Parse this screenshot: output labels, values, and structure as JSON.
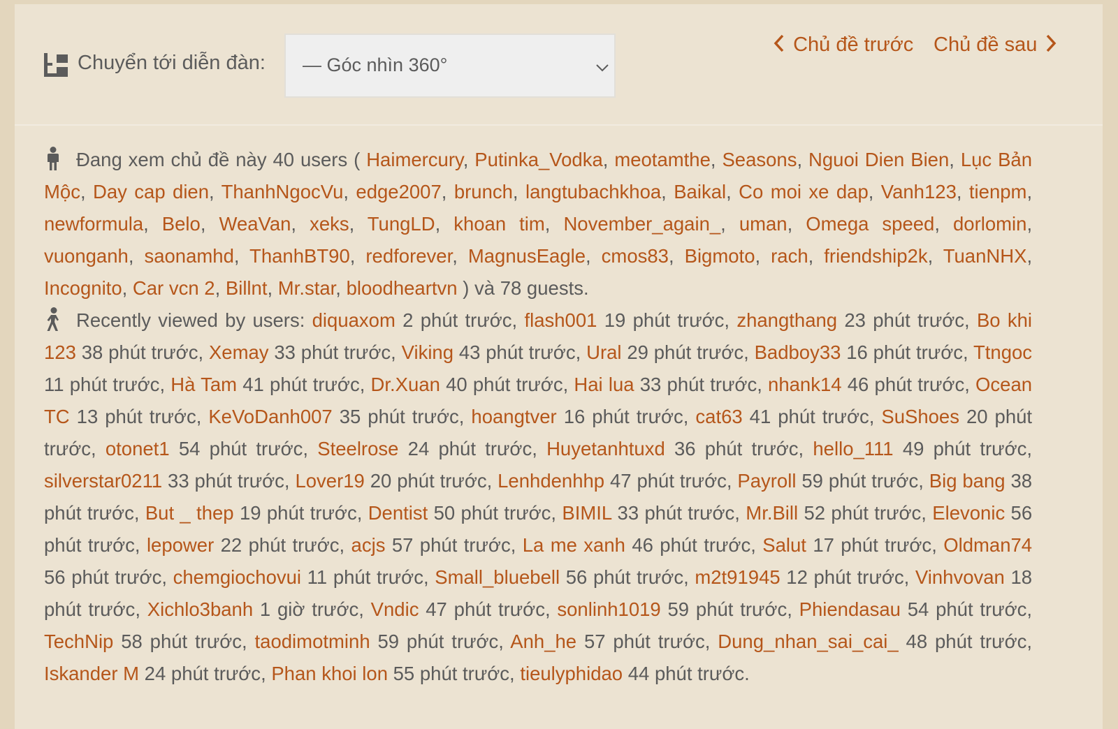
{
  "jump": {
    "label": "Chuyển tới diễn đàn:",
    "selected_forum": "— Góc nhìn 360°"
  },
  "topic_nav": {
    "prev_label": "Chủ đề trước",
    "next_label": "Chủ đề sau"
  },
  "viewing": {
    "prefix": "Đang xem chủ đề này 40 users (",
    "users": [
      "Haimercury",
      "Putinka_Vodka",
      "meotamthe",
      "Seasons",
      "Nguoi Dien Bien",
      "Lục Bản Mộc",
      "Day cap dien",
      "ThanhNgocVu",
      "edge2007",
      "brunch",
      "langtubachkhoa",
      "Baikal",
      "Co moi xe dap",
      "Vanh123",
      "tienpm",
      "newformula",
      "Belo",
      "WeaVan",
      "xeks",
      "TungLD",
      "khoan tim",
      "November_again_",
      "uman",
      "Omega speed",
      "dorlomin",
      "vuonganh",
      "saonamhd",
      "ThanhBT90",
      "redforever",
      "MagnusEagle",
      "cmos83",
      "Bigmoto",
      "rach",
      "friendship2k",
      "TuanNHX",
      "Incognito",
      "Car vcn 2",
      "Billnt",
      "Mr.star",
      "bloodheartvn"
    ],
    "suffix": ") và 78 guests."
  },
  "recent": {
    "prefix": "Recently viewed by users:",
    "entries": [
      {
        "user": "diquaxom",
        "time": "2 phút trước"
      },
      {
        "user": "flash001",
        "time": "19 phút trước"
      },
      {
        "user": "zhangthang",
        "time": "23 phút trước"
      },
      {
        "user": "Bo khi 123",
        "time": "38 phút trước"
      },
      {
        "user": "Xemay",
        "time": "33 phút trước"
      },
      {
        "user": "Viking",
        "time": "43 phút trước"
      },
      {
        "user": "Ural",
        "time": "29 phút trước"
      },
      {
        "user": "Badboy33",
        "time": "16 phút trước"
      },
      {
        "user": "Ttngoc",
        "time": "11 phút trước"
      },
      {
        "user": "Hà Tam",
        "time": "41 phút trước"
      },
      {
        "user": "Dr.Xuan",
        "time": "40 phút trước"
      },
      {
        "user": "Hai lua",
        "time": "33 phút trước"
      },
      {
        "user": "nhank14",
        "time": "46 phút trước"
      },
      {
        "user": "Ocean TC",
        "time": "13 phút trước"
      },
      {
        "user": "KeVoDanh007",
        "time": "35 phút trước"
      },
      {
        "user": "hoangtver",
        "time": "16 phút trước"
      },
      {
        "user": "cat63",
        "time": "41 phút trước"
      },
      {
        "user": "SuShoes",
        "time": "20 phút trước"
      },
      {
        "user": "otonet1",
        "time": "54 phút trước"
      },
      {
        "user": "Steelrose",
        "time": "24 phút trước"
      },
      {
        "user": "Huyetanhtuxd",
        "time": "36 phút trước"
      },
      {
        "user": "hello_111",
        "time": "49 phút trước"
      },
      {
        "user": "silverstar0211",
        "time": "33 phút trước"
      },
      {
        "user": "Lover19",
        "time": "20 phút trước"
      },
      {
        "user": "Lenhdenhhp",
        "time": "47 phút trước"
      },
      {
        "user": "Payroll",
        "time": "59 phút trước"
      },
      {
        "user": "Big bang",
        "time": "38 phút trước"
      },
      {
        "user": "But _ thep",
        "time": "19 phút trước"
      },
      {
        "user": "Dentist",
        "time": "50 phút trước"
      },
      {
        "user": "BIMIL",
        "time": "33 phút trước"
      },
      {
        "user": "Mr.Bill",
        "time": "52 phút trước"
      },
      {
        "user": "Elevonic",
        "time": "56 phút trước"
      },
      {
        "user": "lepower",
        "time": "22 phút trước"
      },
      {
        "user": "acjs",
        "time": "57 phút trước"
      },
      {
        "user": "La me xanh",
        "time": "46 phút trước"
      },
      {
        "user": "Salut",
        "time": "17 phút trước"
      },
      {
        "user": "Oldman74",
        "time": "56 phút trước"
      },
      {
        "user": "chemgiochovui",
        "time": "11 phút trước"
      },
      {
        "user": "Small_bluebell",
        "time": "56 phút trước"
      },
      {
        "user": "m2t91945",
        "time": "12 phút trước"
      },
      {
        "user": "Vinhvovan",
        "time": "18 phút trước"
      },
      {
        "user": "Xichlo3banh",
        "time": "1 giờ trước"
      },
      {
        "user": "Vndic",
        "time": "47 phút trước"
      },
      {
        "user": "sonlinh1019",
        "time": "59 phút trước"
      },
      {
        "user": "Phiendasau",
        "time": "54 phút trước"
      },
      {
        "user": "TechNip",
        "time": "58 phút trước"
      },
      {
        "user": "taodimotminh",
        "time": "59 phút trước"
      },
      {
        "user": "Anh_he",
        "time": "57 phút trước"
      },
      {
        "user": "Dung_nhan_sai_cai_",
        "time": "48 phút trước"
      },
      {
        "user": "Iskander M",
        "time": "24 phút trước"
      },
      {
        "user": "Phan khoi lon",
        "time": "55 phút trước"
      },
      {
        "user": "tieulyphidao",
        "time": "44 phút trước"
      }
    ]
  },
  "colors": {
    "background": "#e3d6bd",
    "panel": "#ece3d2",
    "link": "#b5561a",
    "text": "#5b5b5b",
    "select_bg": "#efefef"
  },
  "icons": {
    "jump": "sitemap-icon",
    "viewing": "standing-person-icon",
    "recent": "walking-person-icon",
    "select": "chevron-down-icon",
    "prev": "chevron-left-icon",
    "next": "chevron-right-icon"
  }
}
